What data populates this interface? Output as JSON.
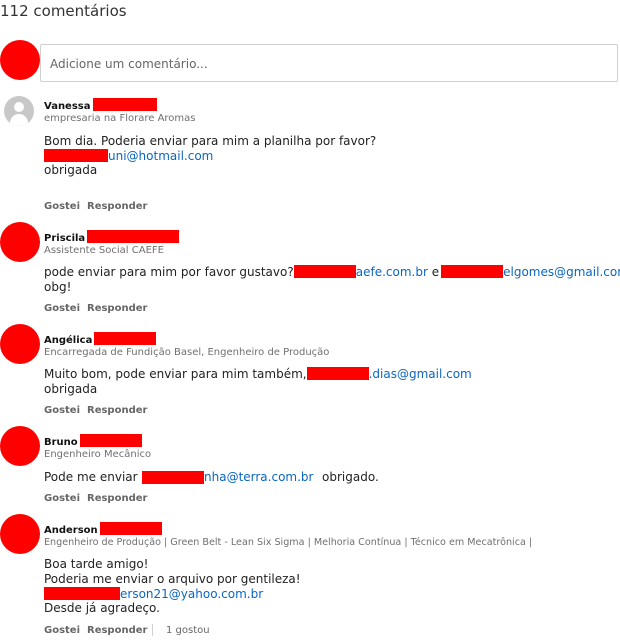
{
  "comments_count": "112 comentários",
  "composer": {
    "placeholder": "Adicione um comentário..."
  },
  "comments": [
    {
      "name": "Vanessa",
      "headline": "empresaria na Florare Aromas",
      "line1": "Bom dia. Poderia enviar para mim a planilha por favor?",
      "email": "uni@hotmail.com",
      "line3": "obrigada",
      "like": "Gostei",
      "reply": "Responder"
    },
    {
      "name": "Priscila",
      "headline": "Assistente Social CAEFE",
      "line1_pre": "pode enviar para mim por favor gustavo?",
      "email1": "aefe.com.br",
      "conj": "e",
      "email2": "elgomes@gmail.com",
      "dot": ".",
      "line2": "obg!",
      "like": "Gostei",
      "reply": "Responder"
    },
    {
      "name": "Angélica",
      "headline": "Encarregada de Fundição Basel, Engenheiro de Produção",
      "line1_pre": "Muito bom, pode enviar para mim também,",
      "email": ".dias@gmail.com",
      "line2": "obrigada",
      "like": "Gostei",
      "reply": "Responder"
    },
    {
      "name": "Bruno",
      "headline": "Engenheiro Mecânico",
      "line1_pre": "Pode me enviar",
      "email": "nha@terra.com.br",
      "line1_post": "obrigado.",
      "like": "Gostei",
      "reply": "Responder"
    },
    {
      "name": "Anderson",
      "headline": "Engenheiro de Produção | Green Belt - Lean Six Sigma | Melhoria Contínua | Técnico em Mecatrônica |",
      "line1": "Boa tarde amigo!",
      "line2": "Poderia me enviar o arquivo por gentileza!",
      "email": "erson21@yahoo.com.br",
      "line4": "Desde já agradeço.",
      "like": "Gostei",
      "reply": "Responder",
      "likes_count": "1 gostou"
    }
  ]
}
